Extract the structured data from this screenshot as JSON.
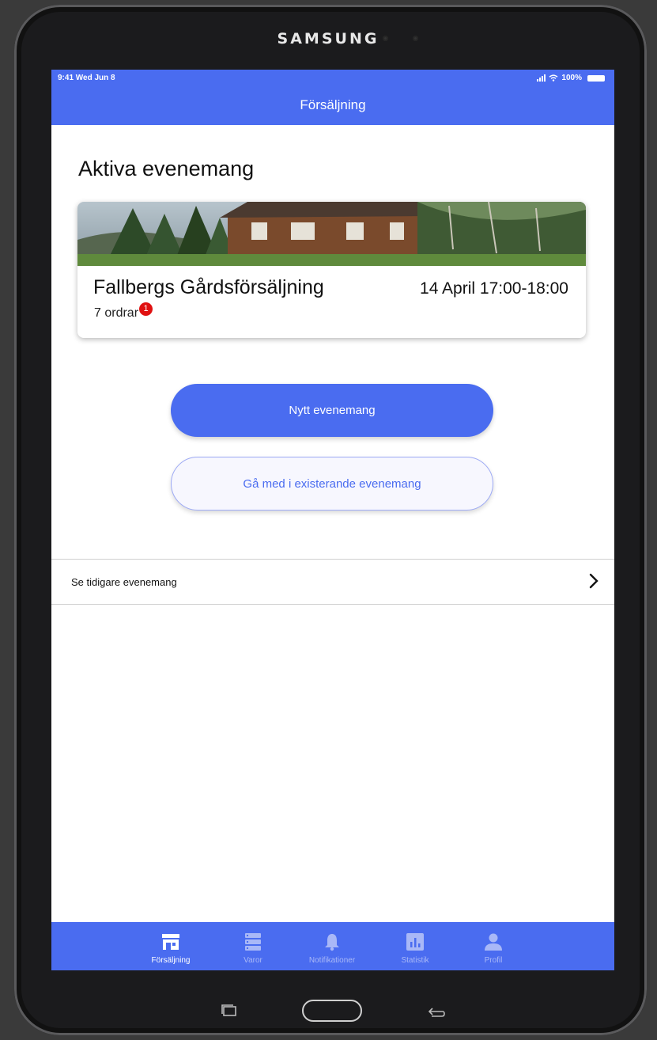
{
  "device": {
    "brand": "SAMSUNG"
  },
  "status_bar": {
    "time": "9:41  Wed Jun 8",
    "battery": "100%"
  },
  "header": {
    "title": "Försäljning"
  },
  "section": {
    "title": "Aktiva evenemang"
  },
  "event": {
    "name": "Fallbergs Gårdsförsäljning",
    "time": "14 April 17:00-18:00",
    "orders": "7 ordrar",
    "badge": "1"
  },
  "buttons": {
    "new_event": "Nytt evenemang",
    "join_event": "Gå med i existerande evenemang"
  },
  "past_events": {
    "label": "Se tidigare evenemang"
  },
  "tabs": [
    {
      "label": "Försäljning",
      "icon": "store-icon",
      "active": true
    },
    {
      "label": "Varor",
      "icon": "list-icon",
      "active": false
    },
    {
      "label": "Notifikationer",
      "icon": "bell-icon",
      "active": false
    },
    {
      "label": "Statistik",
      "icon": "chart-icon",
      "active": false
    },
    {
      "label": "Profil",
      "icon": "person-icon",
      "active": false
    }
  ],
  "colors": {
    "accent": "#4a6cf0",
    "badge": "#e01111"
  }
}
